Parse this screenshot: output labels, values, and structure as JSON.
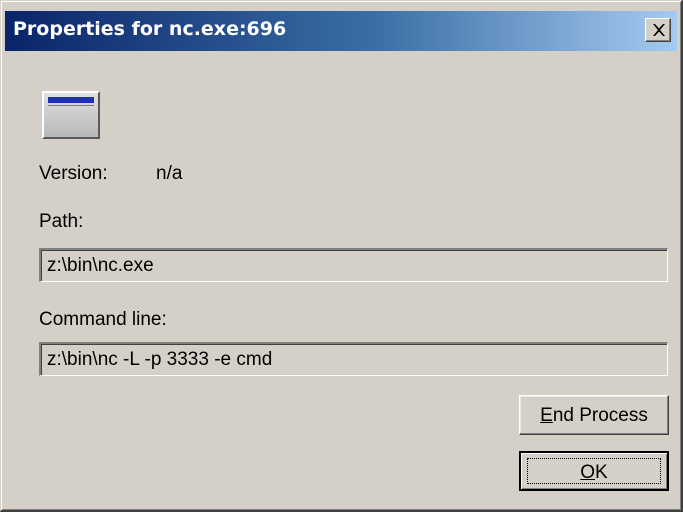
{
  "window": {
    "title": "Properties for nc.exe:696"
  },
  "icons": {
    "close": "close-icon",
    "app": "application-window-icon"
  },
  "version": {
    "label": "Version:",
    "value": "n/a"
  },
  "path": {
    "label": "Path:",
    "value": "z:\\bin\\nc.exe"
  },
  "command_line": {
    "label": "Command line:",
    "value": "z:\\bin\\nc  -L -p 3333 -e cmd"
  },
  "buttons": {
    "end_process": {
      "accel": "E",
      "rest": "nd Process"
    },
    "ok": {
      "accel": "O",
      "rest": "K"
    }
  },
  "colors": {
    "dialog_face": "#d4d0c8",
    "title_gradient_start": "#0a246a",
    "title_gradient_end": "#a6caf0",
    "icon_accent": "#1e32b4"
  }
}
